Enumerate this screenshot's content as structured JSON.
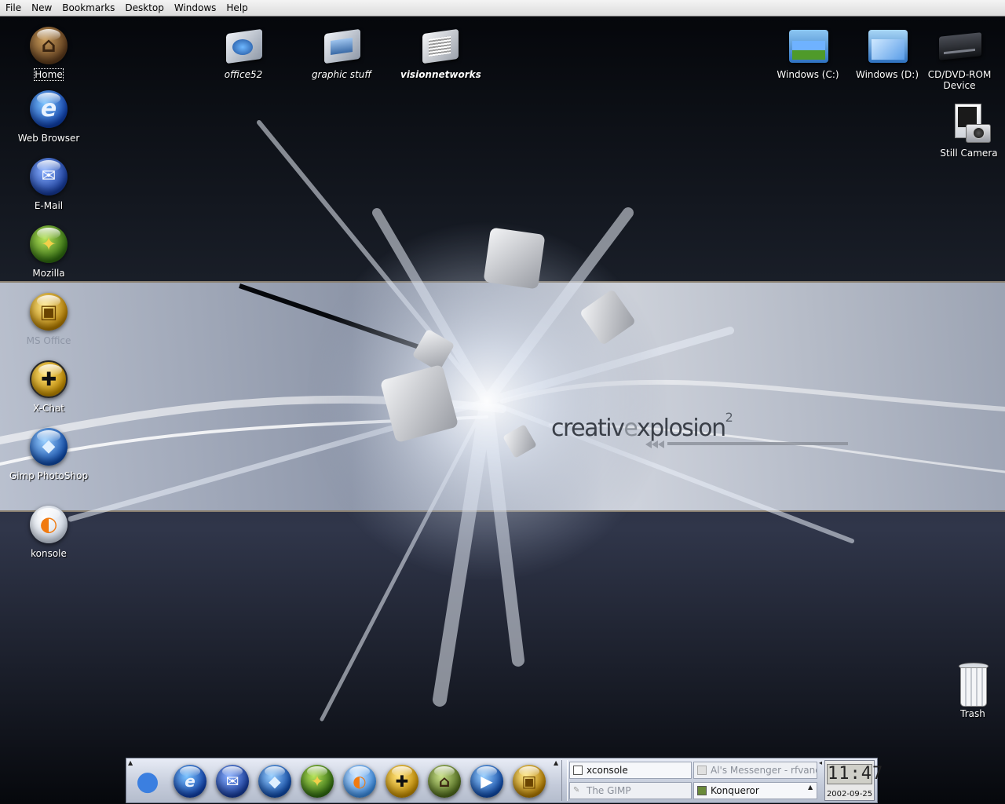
{
  "menubar": {
    "items": [
      "File",
      "New",
      "Bookmarks",
      "Desktop",
      "Windows",
      "Help"
    ]
  },
  "wallpaper": {
    "brand_part1": "creativ",
    "brand_part2": "e",
    "brand_part3": "xplosion",
    "brand_sup": "2"
  },
  "desktop": {
    "left_icons": [
      {
        "label": "Home",
        "icon": "home-icon",
        "color": "#6b4a2a"
      },
      {
        "label": "Web Browser",
        "icon": "web-browser-icon",
        "color": "#1e5fd0"
      },
      {
        "label": "E-Mail",
        "icon": "email-icon",
        "color": "#2350b8"
      },
      {
        "label": "Mozilla",
        "icon": "mozilla-icon",
        "color": "#4f8a1c"
      },
      {
        "label": "MS Office",
        "icon": "office-icon",
        "color": "#d9a800"
      },
      {
        "label": "X-Chat",
        "icon": "xchat-icon",
        "color": "#e0a400"
      },
      {
        "label": "Gimp PhotoShop",
        "icon": "gimp-icon",
        "color": "#1c63c8"
      },
      {
        "label": "konsole",
        "icon": "konsole-fish-icon",
        "color": "#f08a1c"
      }
    ],
    "top_icons": [
      {
        "label": "office52",
        "icon": "folder-icon"
      },
      {
        "label": "graphic stuff",
        "icon": "folder-icon"
      },
      {
        "label": "visionnetworks",
        "icon": "folder-icon"
      }
    ],
    "right_icons": [
      {
        "label": "Windows (C:)",
        "icon": "drive-folder-icon"
      },
      {
        "label": "Windows (D:)",
        "icon": "drive-folder-icon"
      },
      {
        "label": "CD/DVD-ROM Device",
        "icon": "cdrom-drive-icon"
      },
      {
        "label": "Still Camera",
        "icon": "camera-icon"
      }
    ],
    "trash": {
      "label": "Trash",
      "icon": "trash-icon"
    }
  },
  "taskbar": {
    "launchers": [
      {
        "name": "apple-menu-icon",
        "color": "#3b7fe0",
        "glyph": ""
      },
      {
        "name": "web-browser-icon",
        "color": "#1e5fd0",
        "glyph": "e"
      },
      {
        "name": "email-icon",
        "color": "#2350b8",
        "glyph": "✉"
      },
      {
        "name": "gimp-icon",
        "color": "#1c63c8",
        "glyph": "◆"
      },
      {
        "name": "mozilla-icon",
        "color": "#4f8a1c",
        "glyph": "✦"
      },
      {
        "name": "konsole-fish-icon",
        "color": "#3b8be0",
        "glyph": "◐"
      },
      {
        "name": "xchat-icon",
        "color": "#e0a400",
        "glyph": "✚"
      },
      {
        "name": "home-icon",
        "color": "#6b8a3a",
        "glyph": "⌂"
      },
      {
        "name": "media-icon",
        "color": "#1c63c8",
        "glyph": "▶"
      },
      {
        "name": "office-icon",
        "color": "#d9a800",
        "glyph": "▣"
      }
    ],
    "tasks": [
      {
        "label": "xconsole",
        "state": "normal"
      },
      {
        "label": "Al's Messenger - rfvande",
        "state": "dim"
      },
      {
        "label": "The GIMP",
        "state": "dim"
      },
      {
        "label": "Konqueror",
        "state": "normal"
      }
    ],
    "clock": {
      "time": "11:47",
      "date": "2002-09-25"
    }
  }
}
